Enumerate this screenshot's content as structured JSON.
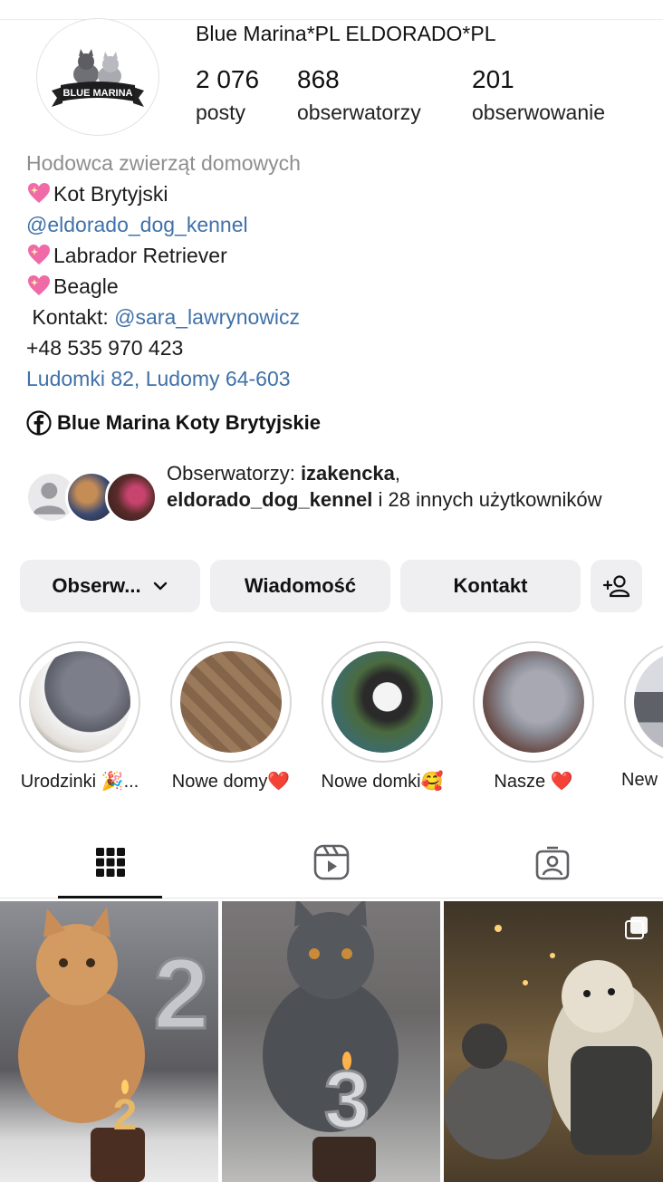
{
  "profile": {
    "username": "Blue Marina*PL ELDORADO*PL",
    "avatar_logo_text": "BLUE MARINA",
    "stats": [
      {
        "value": "2 076",
        "label": "posty"
      },
      {
        "value": "868",
        "label": "obserwatorzy"
      },
      {
        "value": "201",
        "label": "obserwowanie"
      }
    ]
  },
  "bio": {
    "category": "Hodowca zwierząt domowych",
    "line1": "Kot Brytyjski",
    "line2": "@eldorado_dog_kennel",
    "line3": "Labrador Retriever",
    "line4": "Beagle",
    "contact_prefix": " Kontakt: ",
    "contact_handle": "@sara_lawrynowicz",
    "phone": "+48 535 970 423",
    "address": "Ludomki 82, Ludomy 64-603"
  },
  "facebook": {
    "label": "Blue Marina Koty Brytyjskie"
  },
  "followed_by": {
    "prefix": "Obserwatorzy: ",
    "user1": "izakencka",
    "sep": ",",
    "user2": "eldorado_dog_kennel",
    "suffix": " i 28 innych użytkowników"
  },
  "buttons": {
    "follow": "Obserw...",
    "message": "Wiadomość",
    "contact": "Kontakt"
  },
  "highlights": [
    {
      "label": "Urodzinki 🎉..."
    },
    {
      "label": "Nowe domy❤️"
    },
    {
      "label": "Nowe domki🥰"
    },
    {
      "label": "Nasze ❤️"
    },
    {
      "label": "New"
    }
  ],
  "tabs": [
    "grid-tab",
    "reels-tab",
    "tagged-tab"
  ],
  "colors": {
    "link": "#3f71a8",
    "button_bg": "#efeff1",
    "muted": "#8e8e8e"
  }
}
